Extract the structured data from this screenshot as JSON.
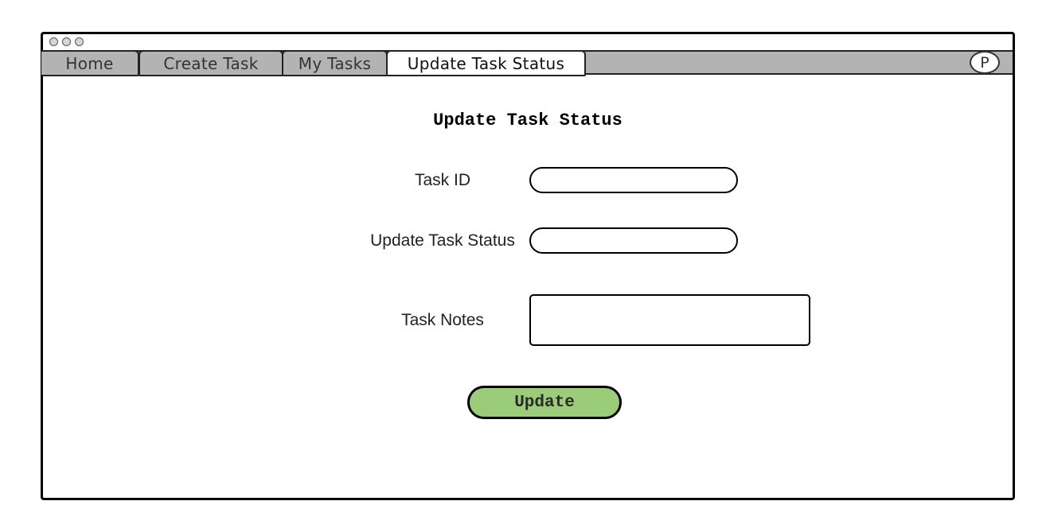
{
  "window": {
    "controls": [
      "close",
      "minimize",
      "maximize"
    ]
  },
  "tabs": [
    {
      "label": "Home",
      "active": false
    },
    {
      "label": "Create Task",
      "active": false
    },
    {
      "label": "My Tasks",
      "active": false
    },
    {
      "label": "Update Task Status",
      "active": true
    }
  ],
  "profile": {
    "initial": "P"
  },
  "form": {
    "title": "Update Task Status",
    "task_id_label": "Task ID",
    "task_id_value": "",
    "status_label": "Update Task Status",
    "status_value": "",
    "notes_label": "Task Notes",
    "notes_value": "",
    "submit_label": "Update"
  },
  "colors": {
    "tabbar": "#b3b3b3",
    "active_tab": "#ffffff",
    "button": "#9bcc7a",
    "border": "#000000"
  }
}
